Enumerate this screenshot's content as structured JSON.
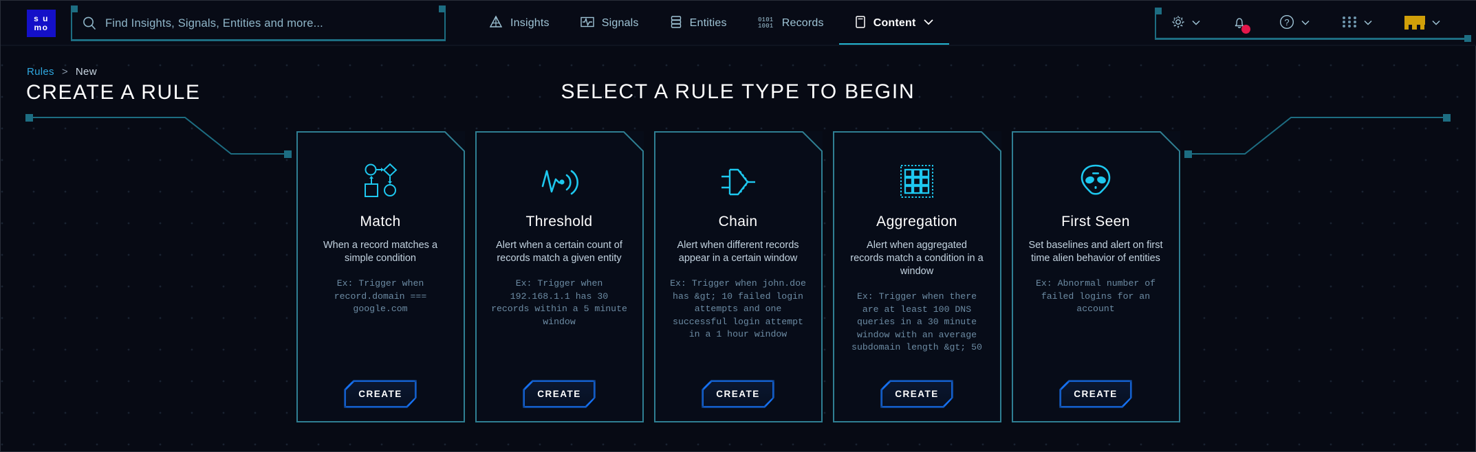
{
  "topbar": {
    "logo": {
      "line1": "s u",
      "line2": "mo",
      "name": "sumo-logo"
    },
    "search": {
      "placeholder": "Find Insights, Signals, Entities and more...",
      "value": ""
    },
    "nav": [
      {
        "label": "Insights",
        "icon": "insights-icon",
        "active": false,
        "caret": false
      },
      {
        "label": "Signals",
        "icon": "signals-icon",
        "active": false,
        "caret": false
      },
      {
        "label": "Entities",
        "icon": "entities-icon",
        "active": false,
        "caret": false
      },
      {
        "label": "Records",
        "icon": "records-icon",
        "active": false,
        "caret": false
      },
      {
        "label": "Content",
        "icon": "content-icon",
        "active": true,
        "caret": true
      }
    ],
    "tools": [
      {
        "name": "settings-gear",
        "icon": "gear-icon",
        "caret": true,
        "badge": false
      },
      {
        "name": "notifications",
        "icon": "bell-icon",
        "caret": false,
        "badge": true
      },
      {
        "name": "help",
        "icon": "question-circle-icon",
        "caret": true,
        "badge": false
      },
      {
        "name": "app-launcher",
        "icon": "grid-apps-icon",
        "caret": true,
        "badge": false
      },
      {
        "name": "user-menu",
        "icon": "avatar-icon",
        "caret": true,
        "badge": false
      }
    ]
  },
  "breadcrumb": {
    "root": "Rules",
    "separator": ">",
    "current": "New"
  },
  "page_title": "CREATE A RULE",
  "center_title": "SELECT A RULE TYPE TO BEGIN",
  "colors": {
    "accent_cyan": "#25b7d3",
    "card_border": "#1d6d82",
    "button_blue": "#1878ff",
    "link_blue": "#2fa8e0",
    "badge_red": "#e4174b",
    "logo_blue": "#1410c8",
    "avatar_gold": "#d09f09",
    "background": "#070a14"
  },
  "cards": [
    {
      "id": "match",
      "icon": "match-flow-icon",
      "title": "Match",
      "description": "When a record matches a simple condition",
      "example": "Ex: Trigger when record.domain === google.com",
      "button": "CREATE"
    },
    {
      "id": "threshold",
      "icon": "threshold-pulse-icon",
      "title": "Threshold",
      "description": "Alert when a certain count of records match a given entity",
      "example": "Ex: Trigger when 192.168.1.1 has 30 records within a 5 minute window",
      "button": "CREATE"
    },
    {
      "id": "chain",
      "icon": "chain-gate-icon",
      "title": "Chain",
      "description": "Alert when different records appear in a certain window",
      "example": "Ex: Trigger when john.doe has &gt; 10 failed login attempts and one successful login attempt in a 1 hour window",
      "button": "CREATE"
    },
    {
      "id": "aggregation",
      "icon": "aggregation-grid-icon",
      "title": "Aggregation",
      "description": "Alert when aggregated records match a condition in a window",
      "example": "Ex: Trigger when there are at least 100 DNS queries in a 30 minute window with an average subdomain length &gt; 50",
      "button": "CREATE"
    },
    {
      "id": "first-seen",
      "icon": "alien-head-icon",
      "title": "First Seen",
      "description": "Set baselines and alert on first time alien behavior of entities",
      "example": "Ex: Abnormal number of failed logins for an account",
      "button": "CREATE"
    }
  ]
}
